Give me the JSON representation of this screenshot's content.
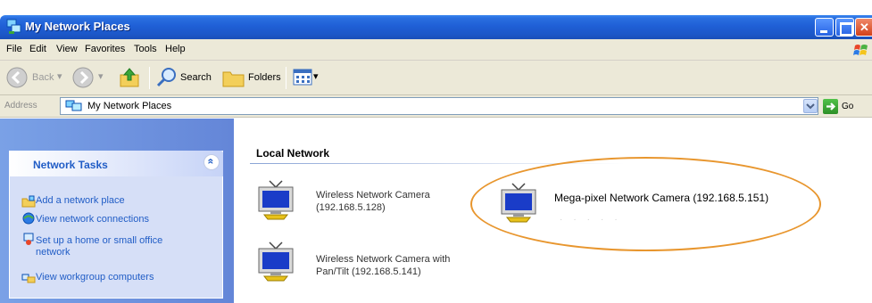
{
  "window": {
    "title": "My Network Places",
    "buttons": {
      "minimize": "minimize",
      "maximize": "maximize",
      "close": "close"
    }
  },
  "menu": {
    "items": [
      "File",
      "Edit",
      "View",
      "Favorites",
      "Tools",
      "Help"
    ]
  },
  "toolbar": {
    "back_label": "Back",
    "search_label": "Search",
    "folders_label": "Folders"
  },
  "address": {
    "label": "Address",
    "value": "My Network Places",
    "go_label": "Go"
  },
  "tasks": {
    "title": "Network Tasks",
    "items": [
      {
        "label": "Add a network place",
        "icon": "add-network-place-icon"
      },
      {
        "label": "View network connections",
        "icon": "network-connections-icon"
      },
      {
        "label": "Set up a home or small office network",
        "icon": "setup-network-icon"
      },
      {
        "label": "View workgroup computers",
        "icon": "workgroup-icon"
      }
    ]
  },
  "content": {
    "section_title": "Local Network",
    "cameras": [
      {
        "name": "Wireless Network Camera",
        "address": "(192.168.5.128)"
      },
      {
        "name": "Mega-pixel Network Camera (192.168.5.151)",
        "address": ""
      },
      {
        "name": "Wireless Network Camera with",
        "address": "Pan/Tilt (192.168.5.141)"
      }
    ]
  },
  "colors": {
    "titlebar": "#1f5fd6",
    "chrome": "#ece9d8",
    "taskpane": "#7aa1e6",
    "link": "#215dc6",
    "highlight_ring": "#e8962e"
  }
}
